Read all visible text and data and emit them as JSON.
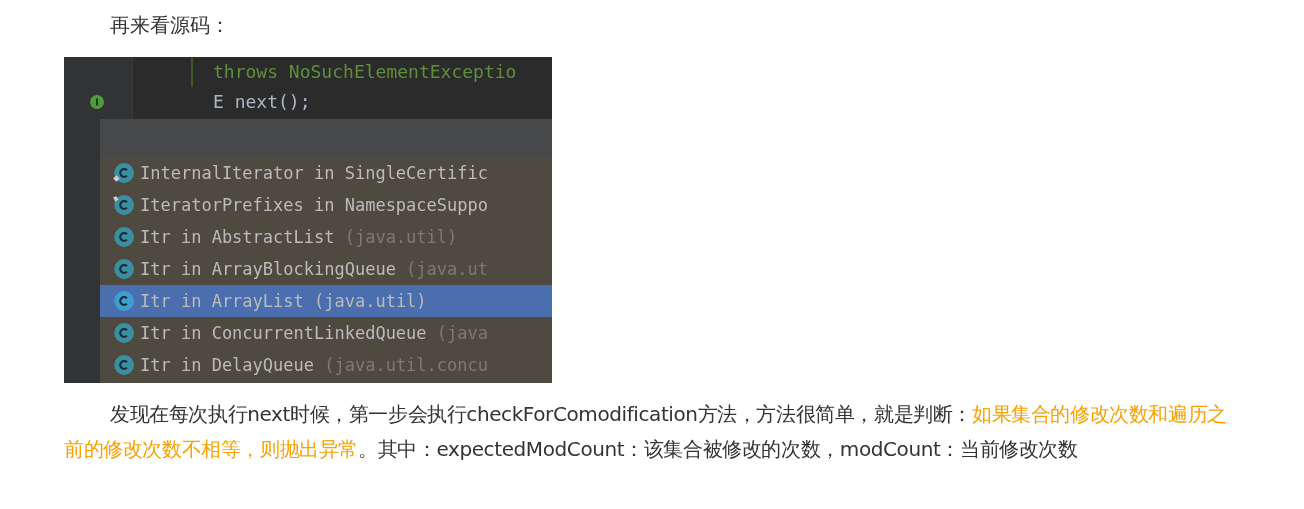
{
  "intro": "再来看源码：",
  "screenshot": {
    "code_lines": [
      {
        "text": "throws NoSuchElementExceptio",
        "kind": "throws"
      },
      {
        "text": "E next();",
        "kind": "call"
      }
    ],
    "completion_items": [
      {
        "name": "InternalIterator in SingleCertific",
        "kind": "inner",
        "selected": false
      },
      {
        "name": "IteratorPrefixes in NamespaceSuppo",
        "kind": "private",
        "selected": false
      },
      {
        "name": "Itr in AbstractList",
        "location": " (java.util)",
        "kind": "plain",
        "selected": false
      },
      {
        "name": "Itr in ArrayBlockingQueue",
        "location": " (java.ut",
        "kind": "plain",
        "selected": false
      },
      {
        "name": "Itr in ArrayList",
        "location": " (java.util)",
        "kind": "plain",
        "selected": true
      },
      {
        "name": "Itr in ConcurrentLinkedQueue",
        "location": " (java",
        "kind": "plain",
        "selected": false
      },
      {
        "name": "Itr in DelayQueue",
        "location": " (java.util.concu",
        "kind": "plain",
        "selected": false
      }
    ]
  },
  "paragraph": [
    {
      "text": "发现在每次执行next时候，第一步会执行checkForComodification方法，方法很简单，就是判断：",
      "highlight": false
    },
    {
      "text": "如果集合的修改次数和遍历之前的修改次数不相等，则抛出异常",
      "highlight": true
    },
    {
      "text": "。其中：expectedModCount：该集合被修改的次数，modCount：当前修改次数",
      "highlight": false
    }
  ]
}
